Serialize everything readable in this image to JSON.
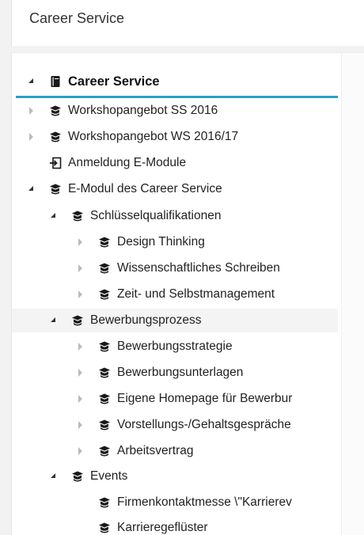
{
  "header": {
    "title": "Career Service"
  },
  "tree": {
    "items": [
      {
        "label": "Career Service",
        "icon": "book-icon",
        "toggle": "expanded",
        "level": 0,
        "root": true
      },
      {
        "label": "Workshopangebot SS 2016",
        "icon": "course-icon",
        "toggle": "collapsed",
        "level": 0
      },
      {
        "label": "Workshopangebot WS 2016/17",
        "icon": "course-icon",
        "toggle": "collapsed",
        "level": 0
      },
      {
        "label": "Anmeldung E-Module",
        "icon": "login-icon",
        "toggle": "none",
        "level": 0
      },
      {
        "label": "E-Modul des Career Service",
        "icon": "course-icon",
        "toggle": "expanded",
        "level": 0
      },
      {
        "label": "Schlüsselqualifikationen",
        "icon": "course-icon",
        "toggle": "expanded",
        "level": 1
      },
      {
        "label": "Design Thinking",
        "icon": "course-icon",
        "toggle": "collapsed",
        "level": 2
      },
      {
        "label": "Wissenschaftliches Schreiben",
        "icon": "course-icon",
        "toggle": "collapsed",
        "level": 2
      },
      {
        "label": "Zeit- und Selbstmanagement",
        "icon": "course-icon",
        "toggle": "collapsed",
        "level": 2
      },
      {
        "label": "Bewerbungsprozess",
        "icon": "course-icon",
        "toggle": "expanded",
        "level": 1,
        "highlight": true
      },
      {
        "label": "Bewerbungsstrategie",
        "icon": "course-icon",
        "toggle": "collapsed",
        "level": 2
      },
      {
        "label": "Bewerbungsunterlagen",
        "icon": "course-icon",
        "toggle": "collapsed",
        "level": 2
      },
      {
        "label": "Eigene Homepage für Bewerbur",
        "icon": "course-icon",
        "toggle": "collapsed",
        "level": 2
      },
      {
        "label": "Vorstellungs-/Gehaltsgespräche",
        "icon": "course-icon",
        "toggle": "collapsed",
        "level": 2
      },
      {
        "label": "Arbeitsvertrag",
        "icon": "course-icon",
        "toggle": "collapsed",
        "level": 2
      },
      {
        "label": "Events",
        "icon": "course-icon",
        "toggle": "expanded",
        "level": 1
      },
      {
        "label": "Firmenkontaktmesse \\\"Karrierev",
        "icon": "course-icon",
        "toggle": "none",
        "level": 2
      },
      {
        "label": "Karrieregeflüster",
        "icon": "course-icon",
        "toggle": "none",
        "level": 2
      }
    ]
  },
  "colors": {
    "accent": "#2aa0c7",
    "icon": "#1a1a1a",
    "expander": "#333333",
    "expander_muted": "#bbbbbb"
  }
}
